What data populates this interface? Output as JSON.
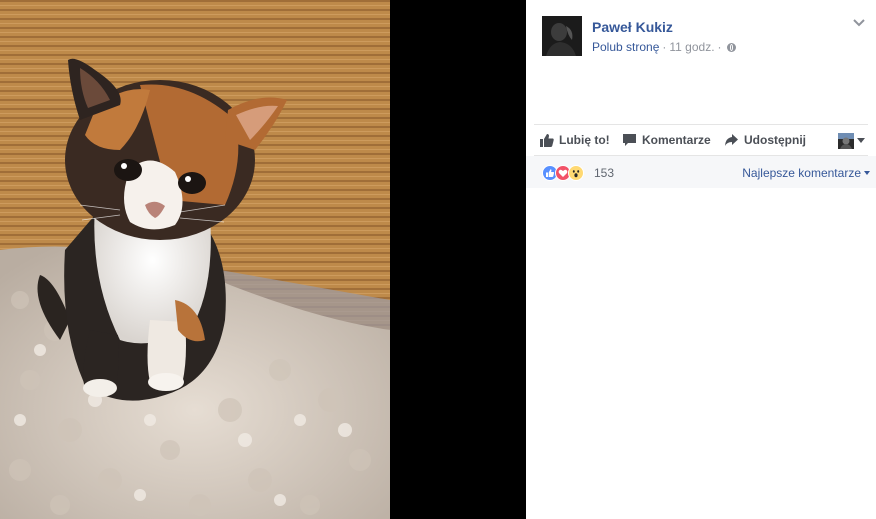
{
  "post": {
    "author": "Paweł Kukiz",
    "like_page": "Polub stronę",
    "separator": "·",
    "time": "11 godz.",
    "privacy_icon": "globe-icon",
    "options_icon": "chevron-down-icon"
  },
  "actions": {
    "like": "Lubię to!",
    "comment": "Komentarze",
    "share": "Udostępnij"
  },
  "reactions": {
    "icons": [
      "like-reaction-icon",
      "love-reaction-icon",
      "wow-reaction-icon"
    ],
    "count": "153",
    "sort_label": "Najlepsze komentarze"
  },
  "photo": {
    "subject_icon": "kitten-photo"
  },
  "colors": {
    "link": "#365899",
    "muted": "#90949c",
    "like_blue": "#5890ff",
    "love_red": "#f25268",
    "wow_yellow": "#ffd972"
  }
}
